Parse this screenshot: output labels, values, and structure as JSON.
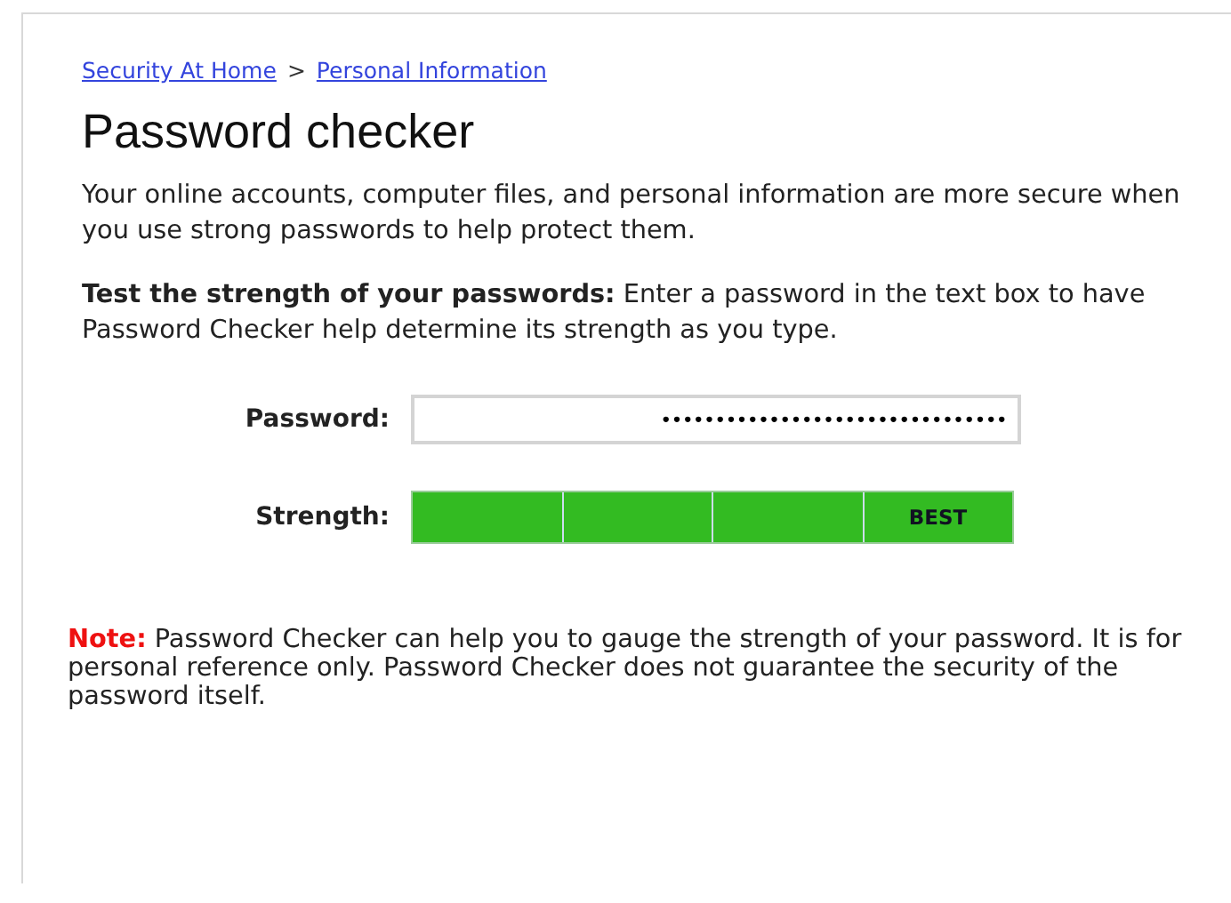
{
  "breadcrumb": [
    {
      "label": "Security At Home"
    },
    {
      "label": "Personal Information"
    }
  ],
  "breadcrumb_separator": ">",
  "title": "Password checker",
  "intro": "Your online accounts, computer files, and personal information are more secure when you use strong passwords to help protect them.",
  "instructions": "**Test the strength of your passwords:** Enter a password in the text box to have Password Checker help determine its strength as you type.",
  "password": {
    "label": "Password:",
    "value": "••••••••••••••••••••••••••••••••"
  },
  "strength": {
    "label": "Strength:",
    "level": 1,
    "rating": "BEST"
  },
  "note": {
    "lead": "Note:",
    "text": "Password Checker can help you to gauge the strength of your password. It is for personal reference only. Password Checker does not guarantee the security of the password itself."
  }
}
